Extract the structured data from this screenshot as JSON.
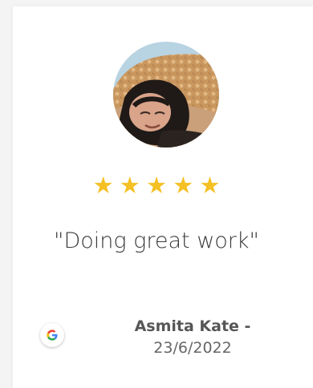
{
  "review": {
    "rating": 5,
    "stars": [
      "★",
      "★",
      "★",
      "★",
      "★"
    ],
    "quote": "\"Doing great work\"",
    "reviewer_name": "Asmita Kate -",
    "date": "23/6/2022",
    "source_icon": "google-icon"
  },
  "colors": {
    "star": "#f5c024",
    "text": "#3a3a3a",
    "name": "#565656"
  }
}
